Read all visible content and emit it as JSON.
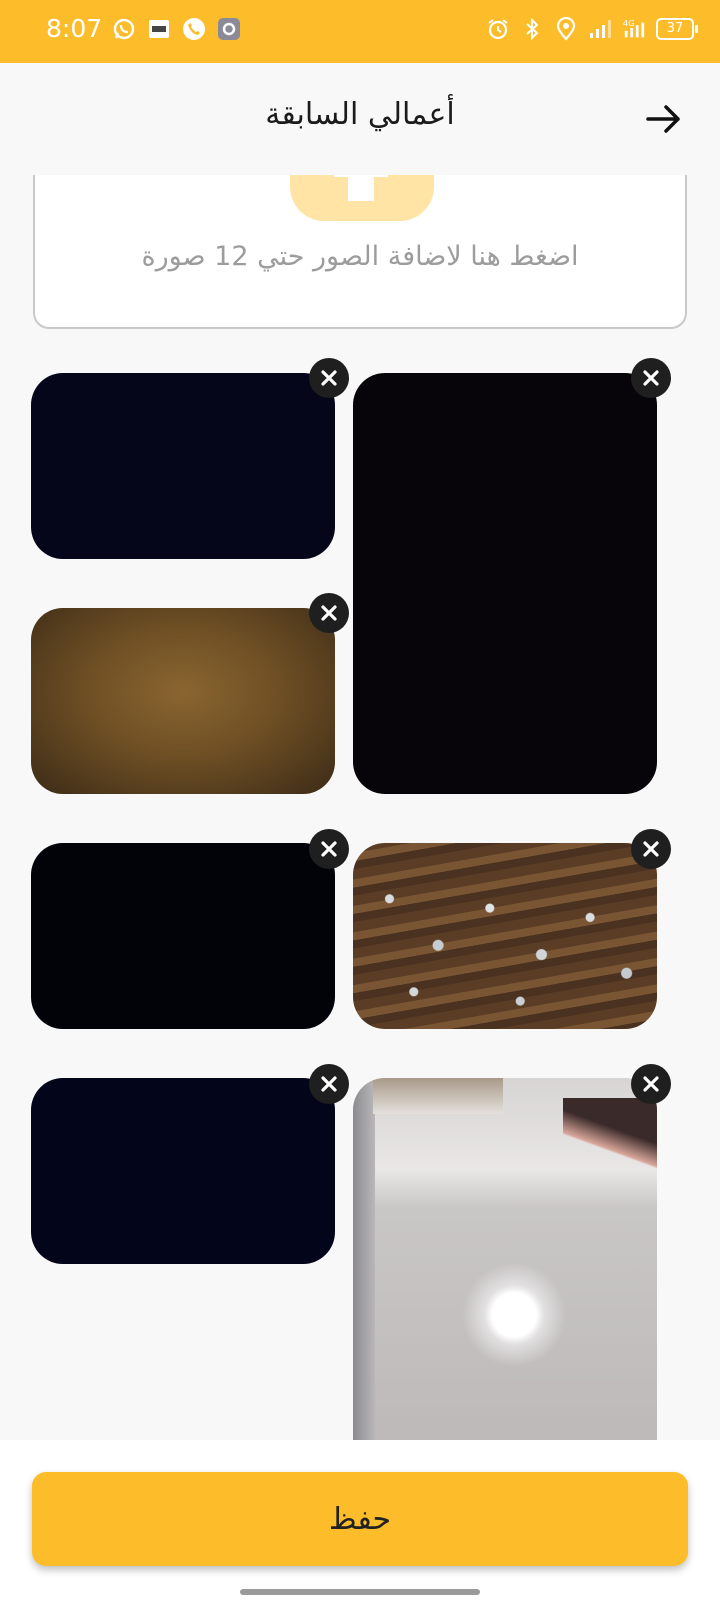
{
  "status_bar": {
    "time": "8:07",
    "battery": "37",
    "left_icons": [
      "whatsapp-icon",
      "gallery-icon",
      "phone-icon",
      "settings-icon"
    ],
    "right_icons": [
      "alarm-icon",
      "bluetooth-icon",
      "location-icon",
      "signal-icon",
      "network-4g-icon",
      "battery-icon"
    ]
  },
  "header": {
    "title": "أعمالي السابقة",
    "back_icon": "arrow-right-icon"
  },
  "upload": {
    "hint": "اضغط هنا لاضافة الصور حتي 12 صورة",
    "icon": "add-photo-icon"
  },
  "photos": [
    {
      "name": "photo-tall-dark",
      "style": "dark"
    },
    {
      "name": "photo-dark-1",
      "style": "dark"
    },
    {
      "name": "photo-brown",
      "style": "brown"
    },
    {
      "name": "photo-texture",
      "style": "texture"
    },
    {
      "name": "photo-dark-2",
      "style": "dark"
    },
    {
      "name": "photo-room",
      "style": "room"
    },
    {
      "name": "photo-dark-3",
      "style": "dark"
    }
  ],
  "footer": {
    "save_label": "حفظ"
  },
  "colors": {
    "accent": "#fdbd2a",
    "background": "#f8f8f8",
    "remove_button": "#1f1f1f"
  }
}
